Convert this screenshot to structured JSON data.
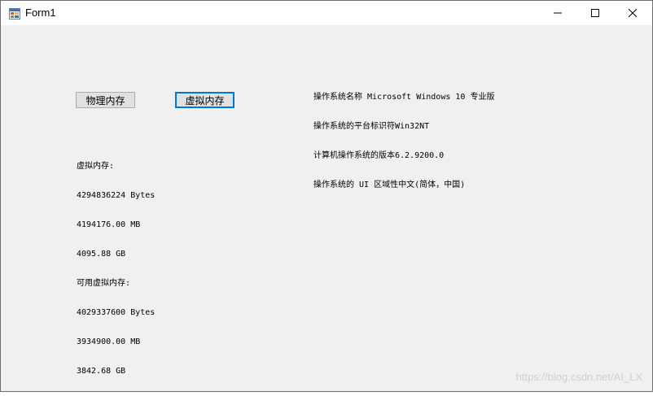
{
  "window": {
    "title": "Form1",
    "icon": "winforms-app-icon",
    "controls": {
      "minimize": "minimize-icon",
      "maximize": "maximize-icon",
      "close": "close-icon"
    }
  },
  "buttons": {
    "physical_memory": "物理内存",
    "virtual_memory": "虚拟内存"
  },
  "os_info": [
    "操作系统名称 Microsoft Windows 10 专业版",
    "操作系统的平台标识符Win32NT",
    "计算机操作系统的版本6.2.9200.0",
    "操作系统的 UI 区域性中文(简体，中国)"
  ],
  "memory_info": [
    "虚拟内存:",
    "4294836224 Bytes",
    "4194176.00 MB",
    "4095.88 GB",
    "可用虚拟内存:",
    "4029337600 Bytes",
    "3934900.00 MB",
    "3842.68 GB"
  ],
  "watermark": "https://blog.csdn.net/AI_LX",
  "colors": {
    "form_background": "#f0f0f0",
    "titlebar": "#ffffff",
    "focus_border": "#0078d7",
    "button_face": "#e1e1e1"
  }
}
